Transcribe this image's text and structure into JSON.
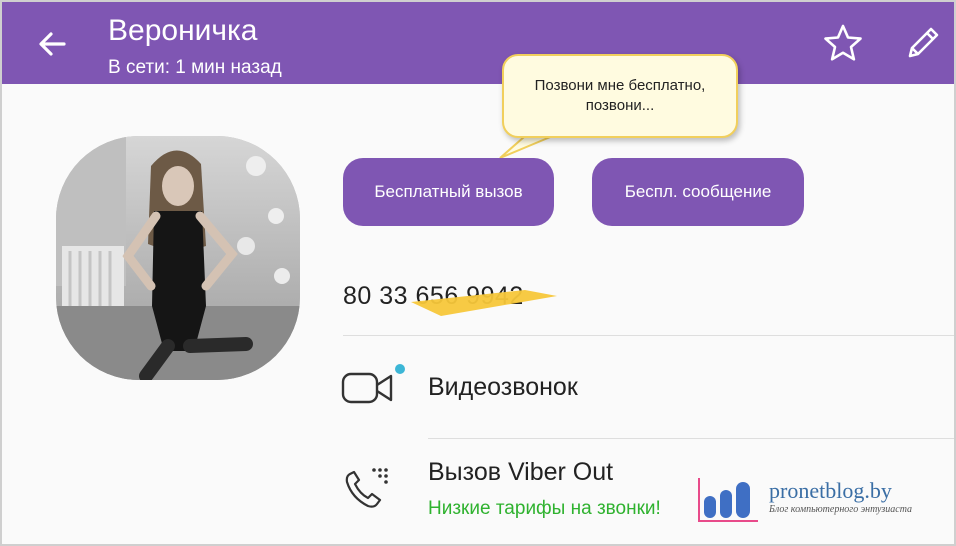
{
  "header": {
    "contact_name": "Вероничка",
    "status": "В сети: 1 мин назад",
    "back_icon": "arrow-left-icon",
    "favorite_icon": "star-icon",
    "edit_icon": "pencil-icon",
    "bg_color": "#7f56b3"
  },
  "callout": {
    "text": "Позвони мне бесплатно, позвони..."
  },
  "actions": {
    "free_call_label": "Бесплатный вызов",
    "free_message_label": "Беспл. сообщение",
    "button_color": "#7f56b3"
  },
  "phone": {
    "number": "80 33 656 9942"
  },
  "rows": {
    "video_call": {
      "label": "Видеозвонок",
      "icon": "video-camera-icon"
    },
    "viber_out": {
      "label": "Вызов Viber Out",
      "sublabel": "Низкие тарифы на звонки!",
      "icon": "phone-dialpad-icon",
      "sublabel_color": "#2fb22f"
    }
  },
  "watermark": {
    "site": "pronetblog.by",
    "tagline": "Блог компьютерного энтузиаста"
  }
}
